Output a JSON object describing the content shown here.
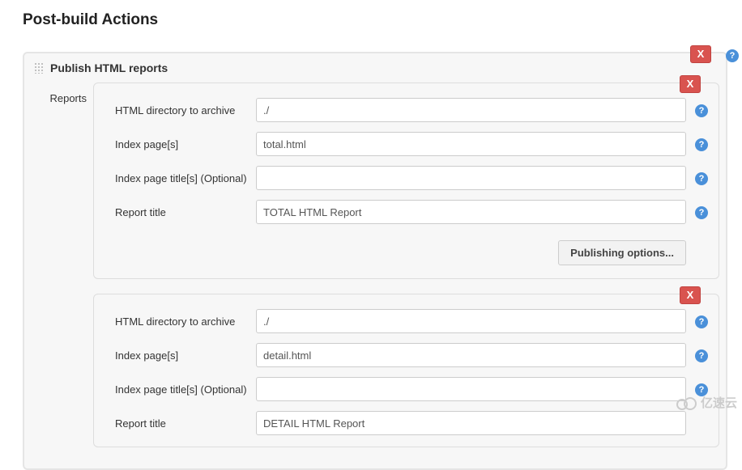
{
  "page_title": "Post-build Actions",
  "panel": {
    "title": "Publish HTML reports",
    "delete_x": "X",
    "reports_label": "Reports",
    "options_button": "Publishing options...",
    "labels": {
      "dir": "HTML directory to archive",
      "index": "Index page[s]",
      "index_title": "Index page title[s] (Optional)",
      "report_title": "Report title"
    },
    "reports": [
      {
        "dir": "./",
        "index": "total.html",
        "index_title": "",
        "report_title": "TOTAL HTML Report"
      },
      {
        "dir": "./",
        "index": "detail.html",
        "index_title": "",
        "report_title": "DETAIL HTML Report"
      }
    ]
  },
  "watermark": "亿速云"
}
